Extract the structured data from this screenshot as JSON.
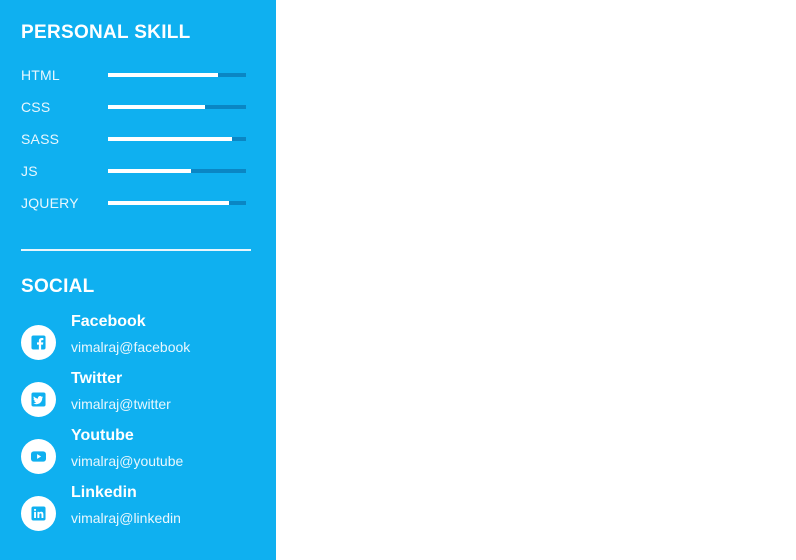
{
  "skills_section": {
    "title": "PERSONAL SKILL",
    "items": [
      {
        "label": "HTML",
        "level": 0.8
      },
      {
        "label": "CSS",
        "level": 0.7
      },
      {
        "label": "SASS",
        "level": 0.9
      },
      {
        "label": "JS",
        "level": 0.6
      },
      {
        "label": "JQUERY",
        "level": 0.88
      }
    ]
  },
  "social_section": {
    "title": "SOCIAL",
    "items": [
      {
        "name": "Facebook",
        "handle": "vimalraj@facebook",
        "icon": "facebook-icon"
      },
      {
        "name": "Twitter",
        "handle": "vimalraj@twitter",
        "icon": "twitter-icon"
      },
      {
        "name": "Youtube",
        "handle": "vimalraj@youtube",
        "icon": "youtube-icon"
      },
      {
        "name": "Linkedin",
        "handle": "vimalraj@linkedin",
        "icon": "linkedin-icon"
      }
    ]
  },
  "colors": {
    "sidebar_bg": "#0fb0f0",
    "track": "#0a86c4",
    "fill": "#ffffff",
    "icon_color": "#0fb0f0"
  }
}
